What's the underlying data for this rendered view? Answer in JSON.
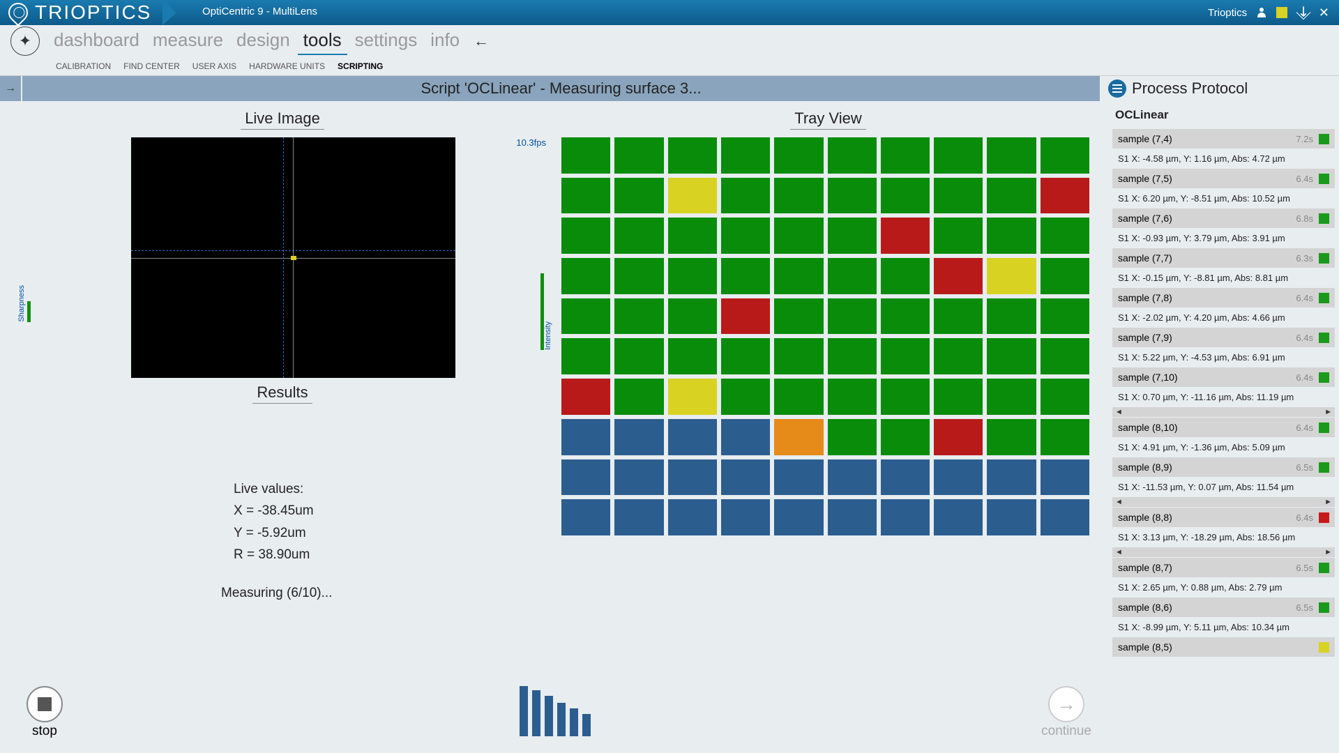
{
  "app": {
    "brand": "TRIOPTICS",
    "title": "OptiCentric 9 - MultiLens",
    "user": "Trioptics"
  },
  "nav": {
    "tabs": [
      "dashboard",
      "measure",
      "design",
      "tools",
      "settings",
      "info"
    ],
    "active": "tools",
    "subtabs": [
      "CALIBRATION",
      "FIND CENTER",
      "USER AXIS",
      "HARDWARE UNITS",
      "SCRIPTING"
    ],
    "subactive": "SCRIPTING"
  },
  "status": "Script 'OCLinear' - Measuring surface 3...",
  "protocol_title": "Process Protocol",
  "live": {
    "title": "Live Image",
    "fps": "10.3fps",
    "sharp": "Sharpness",
    "intensity": "Intensity"
  },
  "results": {
    "title": "Results",
    "live_label": "Live values:",
    "x": "X = -38.45um",
    "y": "Y = -5.92um",
    "r": "R =  38.90um",
    "measuring": "Measuring (6/10)..."
  },
  "tray": {
    "title": "Tray View",
    "rows": [
      [
        "g",
        "g",
        "g",
        "g",
        "g",
        "g",
        "g",
        "g",
        "g",
        "g"
      ],
      [
        "g",
        "g",
        "y",
        "g",
        "g",
        "g",
        "g",
        "g",
        "g",
        "r"
      ],
      [
        "g",
        "g",
        "g",
        "g",
        "g",
        "g",
        "r",
        "g",
        "g",
        "g"
      ],
      [
        "g",
        "g",
        "g",
        "g",
        "g",
        "g",
        "g",
        "r",
        "y",
        "g"
      ],
      [
        "g",
        "g",
        "g",
        "r",
        "g",
        "g",
        "g",
        "g",
        "g",
        "g"
      ],
      [
        "g",
        "g",
        "g",
        "g",
        "g",
        "g",
        "g",
        "g",
        "g",
        "g"
      ],
      [
        "r",
        "g",
        "y",
        "g",
        "g",
        "g",
        "g",
        "g",
        "g",
        "g"
      ],
      [
        "b",
        "b",
        "b",
        "b",
        "o",
        "g",
        "g",
        "r",
        "g",
        "g"
      ],
      [
        "b",
        "b",
        "b",
        "b",
        "b",
        "b",
        "b",
        "b",
        "b",
        "b"
      ],
      [
        "b",
        "b",
        "b",
        "b",
        "b",
        "b",
        "b",
        "b",
        "b",
        "b"
      ]
    ]
  },
  "buttons": {
    "stop": "stop",
    "continue": "continue"
  },
  "protocol": {
    "name": "OCLinear",
    "items": [
      {
        "label": "sample (7,4)",
        "time": "7.2s",
        "color": "g",
        "detail": "S1 X: -4.58 µm, Y: 1.16 µm, Abs: 4.72 µm"
      },
      {
        "label": "sample (7,5)",
        "time": "6.4s",
        "color": "g",
        "detail": "S1 X: 6.20 µm, Y: -8.51 µm, Abs: 10.52 µm"
      },
      {
        "label": "sample (7,6)",
        "time": "6.8s",
        "color": "g",
        "detail": "S1 X: -0.93 µm, Y: 3.79 µm, Abs: 3.91 µm"
      },
      {
        "label": "sample (7,7)",
        "time": "6.3s",
        "color": "g",
        "detail": "S1 X: -0.15 µm, Y: -8.81 µm, Abs: 8.81 µm"
      },
      {
        "label": "sample (7,8)",
        "time": "6.4s",
        "color": "g",
        "detail": "S1 X: -2.02 µm, Y: 4.20 µm, Abs: 4.66 µm"
      },
      {
        "label": "sample (7,9)",
        "time": "6.4s",
        "color": "g",
        "detail": "S1 X: 5.22 µm, Y: -4.53 µm, Abs: 6.91 µm"
      },
      {
        "label": "sample (7,10)",
        "time": "6.4s",
        "color": "g",
        "detail": "S1 X: 0.70 µm, Y: -11.16 µm, Abs: 11.19 µm",
        "scroll": true
      },
      {
        "label": "sample (8,10)",
        "time": "6.4s",
        "color": "g",
        "detail": "S1 X: 4.91 µm, Y: -1.36 µm, Abs: 5.09 µm"
      },
      {
        "label": "sample (8,9)",
        "time": "6.5s",
        "color": "g",
        "detail": "S1 X: -11.53 µm, Y: 0.07 µm, Abs: 11.54 µm",
        "scroll": true
      },
      {
        "label": "sample (8,8)",
        "time": "6.4s",
        "color": "r",
        "detail": "S1 X: 3.13 µm, Y: -18.29 µm, Abs: 18.56 µm",
        "scroll": true
      },
      {
        "label": "sample (8,7)",
        "time": "6.5s",
        "color": "g",
        "detail": "S1 X: 2.65 µm, Y: 0.88 µm, Abs: 2.79 µm"
      },
      {
        "label": "sample (8,6)",
        "time": "6.5s",
        "color": "g",
        "detail": "S1 X: -8.99 µm, Y: 5.11 µm, Abs: 10.34 µm"
      },
      {
        "label": "sample (8,5)",
        "time": "",
        "color": "y",
        "detail": ""
      }
    ]
  },
  "signal_heights": [
    72,
    66,
    58,
    48,
    40,
    32
  ]
}
